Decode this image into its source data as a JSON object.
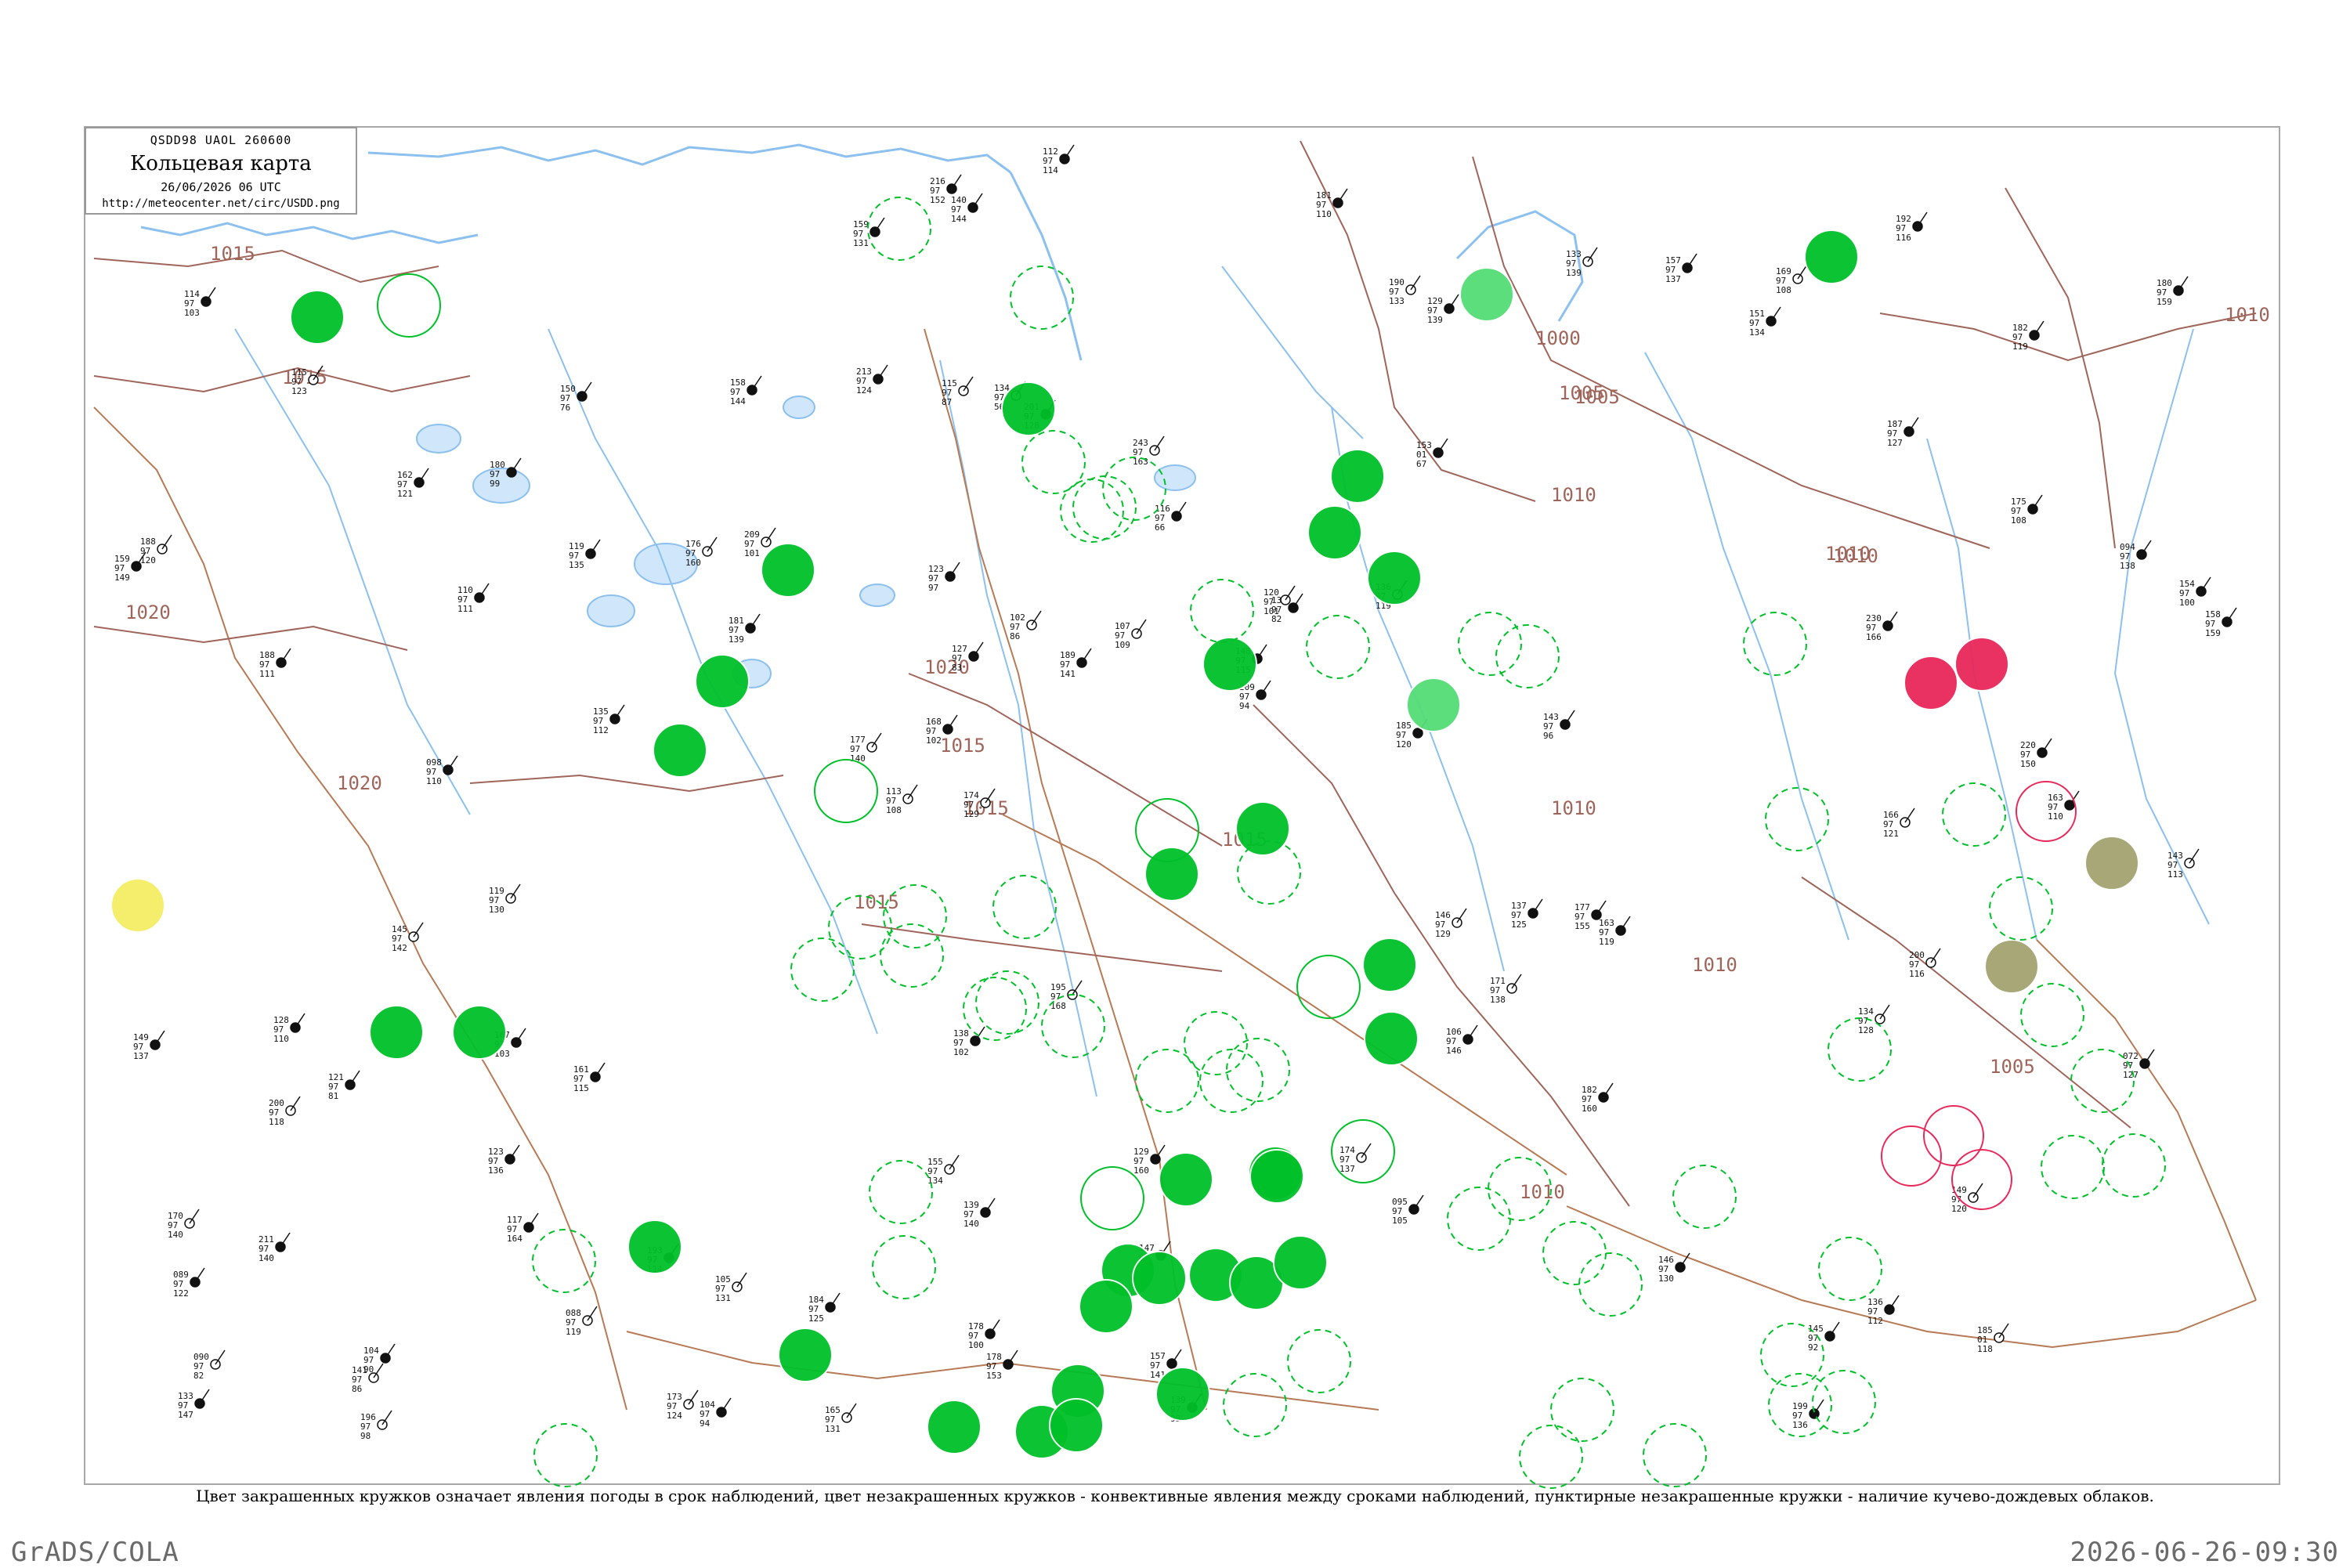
{
  "header": {
    "code": "QSDD98  UAOL  260600",
    "title": "Кольцевая карта",
    "date": "26/06/2026 06 UTC",
    "url": "http://meteocenter.net/circ/USDD.png"
  },
  "caption": "Цвет закрашенных кружков означает явления погоды в срок наблюдений, цвет незакрашенных кружков - конвективные явления между сроками наблюдений, пунктирные незакрашенные кружки - наличие кучево-дождевых облаков.",
  "footer": {
    "left": "GrADS/COLA",
    "right": "2026-06-26-09:30"
  },
  "colors": {
    "isobar": "#a0655a",
    "water": "#8cc0ee",
    "border": "#b77a55",
    "green": "#00c02a",
    "light_green": "#55dd77",
    "red": "#e8285a",
    "yellow": "#f5ee66",
    "olive": "#a3a370",
    "station_text": "#111111"
  },
  "isobar_labels": [
    "1015",
    "1015",
    "1020",
    "1020",
    "1020",
    "1015",
    "1015",
    "1015",
    "1015",
    "1010",
    "1010",
    "1010",
    "1010",
    "1005",
    "1005",
    "1000",
    "1010",
    "1010",
    "1010",
    "1005"
  ],
  "stations": [
    {
      "t": "185",
      "d": "01",
      "p": "118"
    },
    {
      "t": "188",
      "d": "97",
      "p": "111"
    },
    {
      "t": "182",
      "d": "97",
      "p": "119"
    },
    {
      "t": "113",
      "d": "97",
      "p": "108"
    },
    {
      "t": "153",
      "d": "01",
      "p": "67"
    },
    {
      "t": "104",
      "d": "97",
      "p": "90"
    },
    {
      "t": "115",
      "d": "97",
      "p": "87"
    },
    {
      "t": "116",
      "d": "97",
      "p": "66"
    },
    {
      "t": "121",
      "d": "97",
      "p": "81"
    },
    {
      "t": "209",
      "d": "97",
      "p": "101"
    },
    {
      "t": "089",
      "d": "97",
      "p": "122"
    },
    {
      "t": "117",
      "d": "97",
      "p": "164"
    },
    {
      "t": "134",
      "d": "97",
      "p": "56"
    },
    {
      "t": "131",
      "d": "97",
      "p": "82"
    },
    {
      "t": "163",
      "d": "97",
      "p": "119"
    },
    {
      "t": "115",
      "d": "97",
      "p": "123"
    },
    {
      "t": "140",
      "d": "97",
      "p": "144"
    },
    {
      "t": "158",
      "d": "97",
      "p": "159"
    },
    {
      "t": "146",
      "d": "97",
      "p": "129"
    },
    {
      "t": "175",
      "d": "97",
      "p": "108"
    },
    {
      "t": "168",
      "d": "97",
      "p": "102"
    },
    {
      "t": "155",
      "d": "97",
      "p": "134"
    },
    {
      "t": "127",
      "d": "97",
      "p": "83"
    },
    {
      "t": "150",
      "d": "97",
      "p": "76"
    },
    {
      "t": "133",
      "d": "97",
      "p": "139"
    },
    {
      "t": "161",
      "d": "97",
      "p": "115"
    },
    {
      "t": "145",
      "d": "97",
      "p": "92"
    },
    {
      "t": "149",
      "d": "97",
      "p": "120"
    },
    {
      "t": "177",
      "d": "97",
      "p": "155"
    },
    {
      "t": "139",
      "d": "97",
      "p": "93"
    },
    {
      "t": "176",
      "d": "97",
      "p": "160"
    },
    {
      "t": "110",
      "d": "97",
      "p": "111"
    },
    {
      "t": "106",
      "d": "97",
      "p": "146"
    },
    {
      "t": "088",
      "d": "97",
      "p": "119"
    },
    {
      "t": "094",
      "d": "97",
      "p": "138"
    },
    {
      "t": "148",
      "d": "97",
      "p": "115"
    },
    {
      "t": "090",
      "d": "97",
      "p": "82"
    },
    {
      "t": "139",
      "d": "97",
      "p": "140"
    },
    {
      "t": "209",
      "d": "97",
      "p": "94"
    },
    {
      "t": "200",
      "d": "97",
      "p": "118"
    },
    {
      "t": "187",
      "d": "97",
      "p": "127"
    },
    {
      "t": "180",
      "d": "97",
      "p": "159"
    },
    {
      "t": "171",
      "d": "97",
      "p": "138"
    },
    {
      "t": "095",
      "d": "97",
      "p": "105"
    },
    {
      "t": "123",
      "d": "97",
      "p": "136"
    },
    {
      "t": "196",
      "d": "97",
      "p": "98"
    },
    {
      "t": "133",
      "d": "97",
      "p": "147"
    },
    {
      "t": "129",
      "d": "97",
      "p": "160"
    },
    {
      "t": "169",
      "d": "97",
      "p": "108"
    },
    {
      "t": "112",
      "d": "97",
      "p": "114"
    },
    {
      "t": "135",
      "d": "97",
      "p": "112"
    },
    {
      "t": "188",
      "d": "97",
      "p": "120"
    },
    {
      "t": "180",
      "d": "97",
      "p": "99"
    },
    {
      "t": "157",
      "d": "97",
      "p": "137"
    },
    {
      "t": "141",
      "d": "97",
      "p": "86"
    },
    {
      "t": "181",
      "d": "97",
      "p": "110"
    },
    {
      "t": "159",
      "d": "97",
      "p": "131"
    },
    {
      "t": "102",
      "d": "97",
      "p": "86"
    },
    {
      "t": "072",
      "d": "97",
      "p": "127"
    },
    {
      "t": "138",
      "d": "97",
      "p": "102"
    },
    {
      "t": "105",
      "d": "97",
      "p": "131"
    },
    {
      "t": "137",
      "d": "97",
      "p": "125"
    },
    {
      "t": "119",
      "d": "97",
      "p": "135"
    },
    {
      "t": "170",
      "d": "97",
      "p": "140"
    },
    {
      "t": "156",
      "d": "97",
      "p": "105"
    },
    {
      "t": "162",
      "d": "97",
      "p": "121"
    },
    {
      "t": "143",
      "d": "97",
      "p": "113"
    },
    {
      "t": "123",
      "d": "97",
      "p": "97"
    },
    {
      "t": "147",
      "d": "97",
      "p": "104"
    },
    {
      "t": "107",
      "d": "97",
      "p": "109"
    },
    {
      "t": "211",
      "d": "97",
      "p": "140"
    },
    {
      "t": "185",
      "d": "97",
      "p": "120"
    },
    {
      "t": "200",
      "d": "97",
      "p": "116"
    },
    {
      "t": "178",
      "d": "97",
      "p": "100"
    },
    {
      "t": "230",
      "d": "97",
      "p": "166"
    },
    {
      "t": "195",
      "d": "97",
      "p": "168"
    },
    {
      "t": "146",
      "d": "97",
      "p": "130"
    },
    {
      "t": "157",
      "d": "97",
      "p": "141"
    },
    {
      "t": "174",
      "d": "97",
      "p": "137"
    },
    {
      "t": "216",
      "d": "97",
      "p": "152"
    },
    {
      "t": "163",
      "d": "97",
      "p": "110"
    },
    {
      "t": "136",
      "d": "97",
      "p": "119"
    },
    {
      "t": "182",
      "d": "97",
      "p": "160"
    },
    {
      "t": "189",
      "d": "97",
      "p": "141"
    },
    {
      "t": "134",
      "d": "97",
      "p": "128"
    },
    {
      "t": "159",
      "d": "97",
      "p": "149"
    },
    {
      "t": "178",
      "d": "97",
      "p": "153"
    },
    {
      "t": "190",
      "d": "97",
      "p": "133"
    },
    {
      "t": "129",
      "d": "97",
      "p": "139"
    },
    {
      "t": "098",
      "d": "97",
      "p": "110"
    },
    {
      "t": "173",
      "d": "97",
      "p": "124"
    },
    {
      "t": "220",
      "d": "97",
      "p": "150"
    },
    {
      "t": "154",
      "d": "97",
      "p": "100"
    },
    {
      "t": "145",
      "d": "97",
      "p": "142"
    },
    {
      "t": "167",
      "d": "97",
      "p": "103"
    },
    {
      "t": "193",
      "d": "97",
      "p": "114"
    },
    {
      "t": "120",
      "d": "97",
      "p": "101"
    },
    {
      "t": "151",
      "d": "97",
      "p": "134"
    },
    {
      "t": "181",
      "d": "97",
      "p": "139"
    },
    {
      "t": "166",
      "d": "97",
      "p": "121"
    },
    {
      "t": "114",
      "d": "97",
      "p": "103"
    },
    {
      "t": "201",
      "d": "97",
      "p": "128"
    },
    {
      "t": "177",
      "d": "97",
      "p": "140"
    },
    {
      "t": "104",
      "d": "97",
      "p": "94"
    },
    {
      "t": "149",
      "d": "97",
      "p": "137"
    },
    {
      "t": "174",
      "d": "97",
      "p": "129"
    },
    {
      "t": "192",
      "d": "97",
      "p": "116"
    },
    {
      "t": "213",
      "d": "97",
      "p": "124"
    },
    {
      "t": "165",
      "d": "97",
      "p": "131"
    },
    {
      "t": "128",
      "d": "97",
      "p": "110"
    },
    {
      "t": "199",
      "d": "97",
      "p": "136"
    },
    {
      "t": "243",
      "d": "97",
      "p": "163"
    },
    {
      "t": "158",
      "d": "97",
      "p": "144"
    },
    {
      "t": "143",
      "d": "97",
      "p": "96"
    },
    {
      "t": "119",
      "d": "97",
      "p": "130"
    },
    {
      "t": "136",
      "d": "97",
      "p": "112"
    },
    {
      "t": "184",
      "d": "97",
      "p": "125"
    }
  ]
}
